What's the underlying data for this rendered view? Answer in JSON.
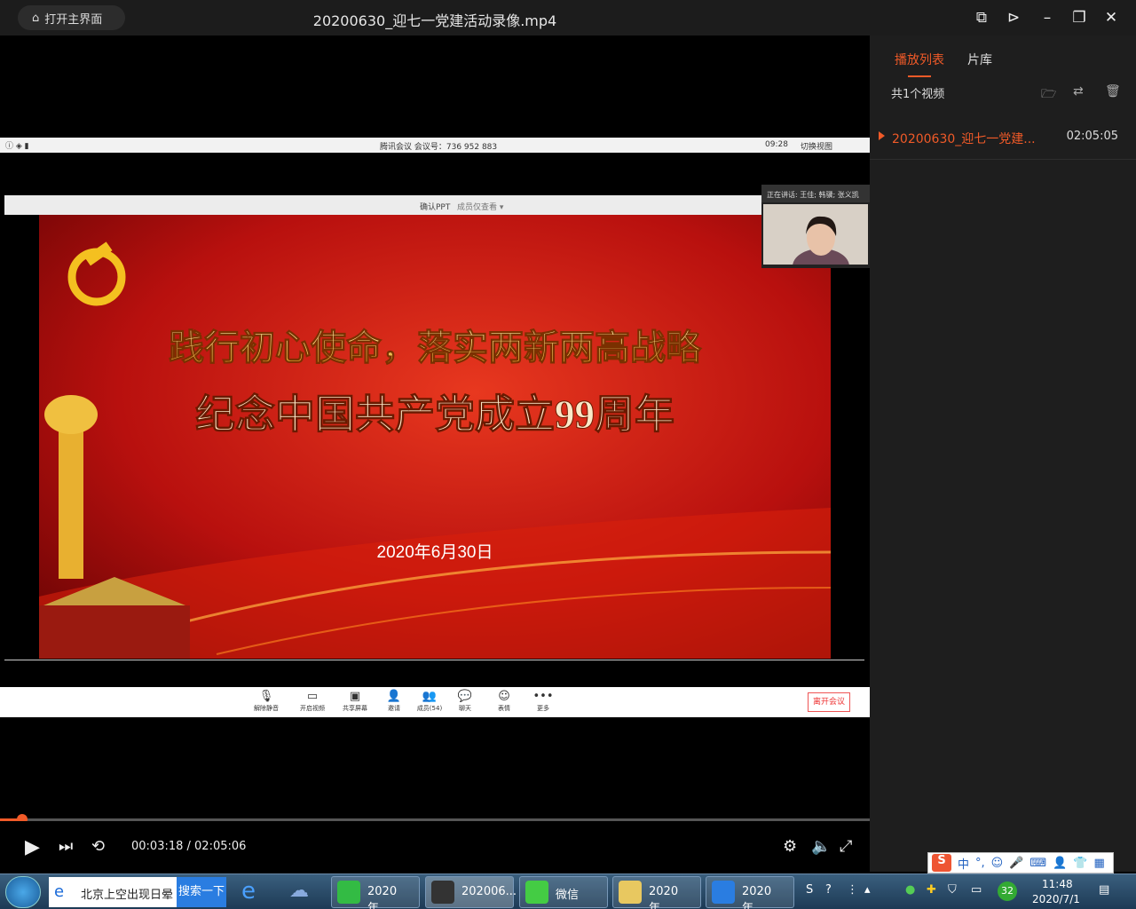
{
  "window": {
    "title": "20200630_迎七一党建活动录像.mp4",
    "home_label": "打开主界面"
  },
  "sidebar": {
    "tabs": [
      "播放列表",
      "片库"
    ],
    "count_label": "共1个视频",
    "items": [
      {
        "name": "20200630_迎七一党建...",
        "duration": "02:05:05"
      }
    ]
  },
  "video": {
    "meeting_bar": {
      "text": "腾讯会议 会议号：736 952 883",
      "time": "09:28",
      "switch_label": "切换视图"
    },
    "ppt_bar": {
      "confirm": "确认PPT",
      "member": "成员仅查看 ▾"
    },
    "slide": {
      "title": "践行初心使命，落实两新两高战略",
      "subtitle": "纪念中国共产党成立99周年",
      "date": "2020年6月30日"
    },
    "speaker": {
      "label": "正在讲话: 王佳; 韩骥; 张义凯",
      "name": "王佳"
    },
    "toolbar": {
      "buttons": [
        "解除静音",
        "开启视频",
        "共享屏幕",
        "邀请",
        "成员(54)",
        "聊天",
        "表情",
        "更多"
      ],
      "leave": "离开会议"
    }
  },
  "player": {
    "current_time": "00:03:18",
    "total_time": "02:05:06",
    "time_display": "00:03:18 / 02:05:06",
    "progress_fraction": 0.026
  },
  "taskbar": {
    "search_text": "北京上空出现日晕",
    "search_button": "搜索一下",
    "tasks": [
      "2020年...",
      "202006...",
      "微信",
      "2020年...",
      "2020年..."
    ],
    "clock_time": "11:48",
    "clock_date": "2020/7/1",
    "tray_badge": "32"
  },
  "ime": {
    "lang": "中"
  }
}
